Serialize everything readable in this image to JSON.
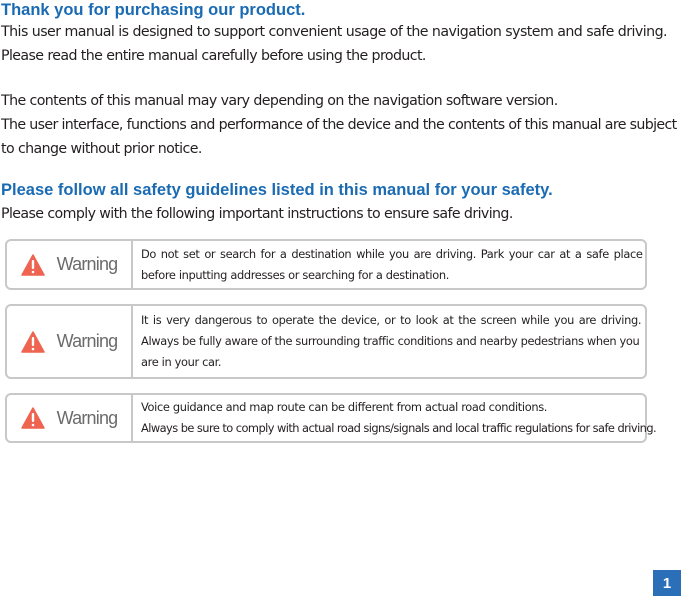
{
  "intro": {
    "heading": "Thank you for purchasing our product.",
    "lines": [
      "This user manual is designed to support convenient usage of the navigation system and safe driving.",
      "Please read the entire manual carefully before using the product."
    ]
  },
  "notice": {
    "lines": [
      "The contents of this manual may vary depending on the navigation software version.",
      "The user interface, functions and performance of the device and the contents of this manual are subject",
      "to change without prior notice."
    ]
  },
  "safety": {
    "heading": "Please follow all safety guidelines listed in this manual for your safety.",
    "subtext": "Please comply with the following important instructions to ensure safe driving."
  },
  "warnings": [
    {
      "icon": "warning-triangle-icon",
      "label": "Warning",
      "lines": [
        "Do not set or search for a destination while you are driving. Park your car at a safe place",
        "before inputting addresses or searching for a destination."
      ]
    },
    {
      "icon": "warning-triangle-icon",
      "label": "Warning",
      "lines": [
        "It is very dangerous to operate the device, or to look at the screen while you are driving.",
        "Always be fully aware of the surrounding traffic conditions and nearby pedestrians when you",
        "are in your car."
      ]
    },
    {
      "icon": "warning-triangle-icon",
      "label": "Warning",
      "lines": [
        "Voice guidance and map route can be different from actual road conditions.",
        "Always be sure to comply with actual road signs/signals and local traffic regulations for safe driving."
      ]
    }
  ],
  "colors": {
    "heading_blue": "#1a6bb3",
    "warning_red": "#ee6450",
    "page_badge": "#2b6fb8"
  },
  "page_number": "1"
}
